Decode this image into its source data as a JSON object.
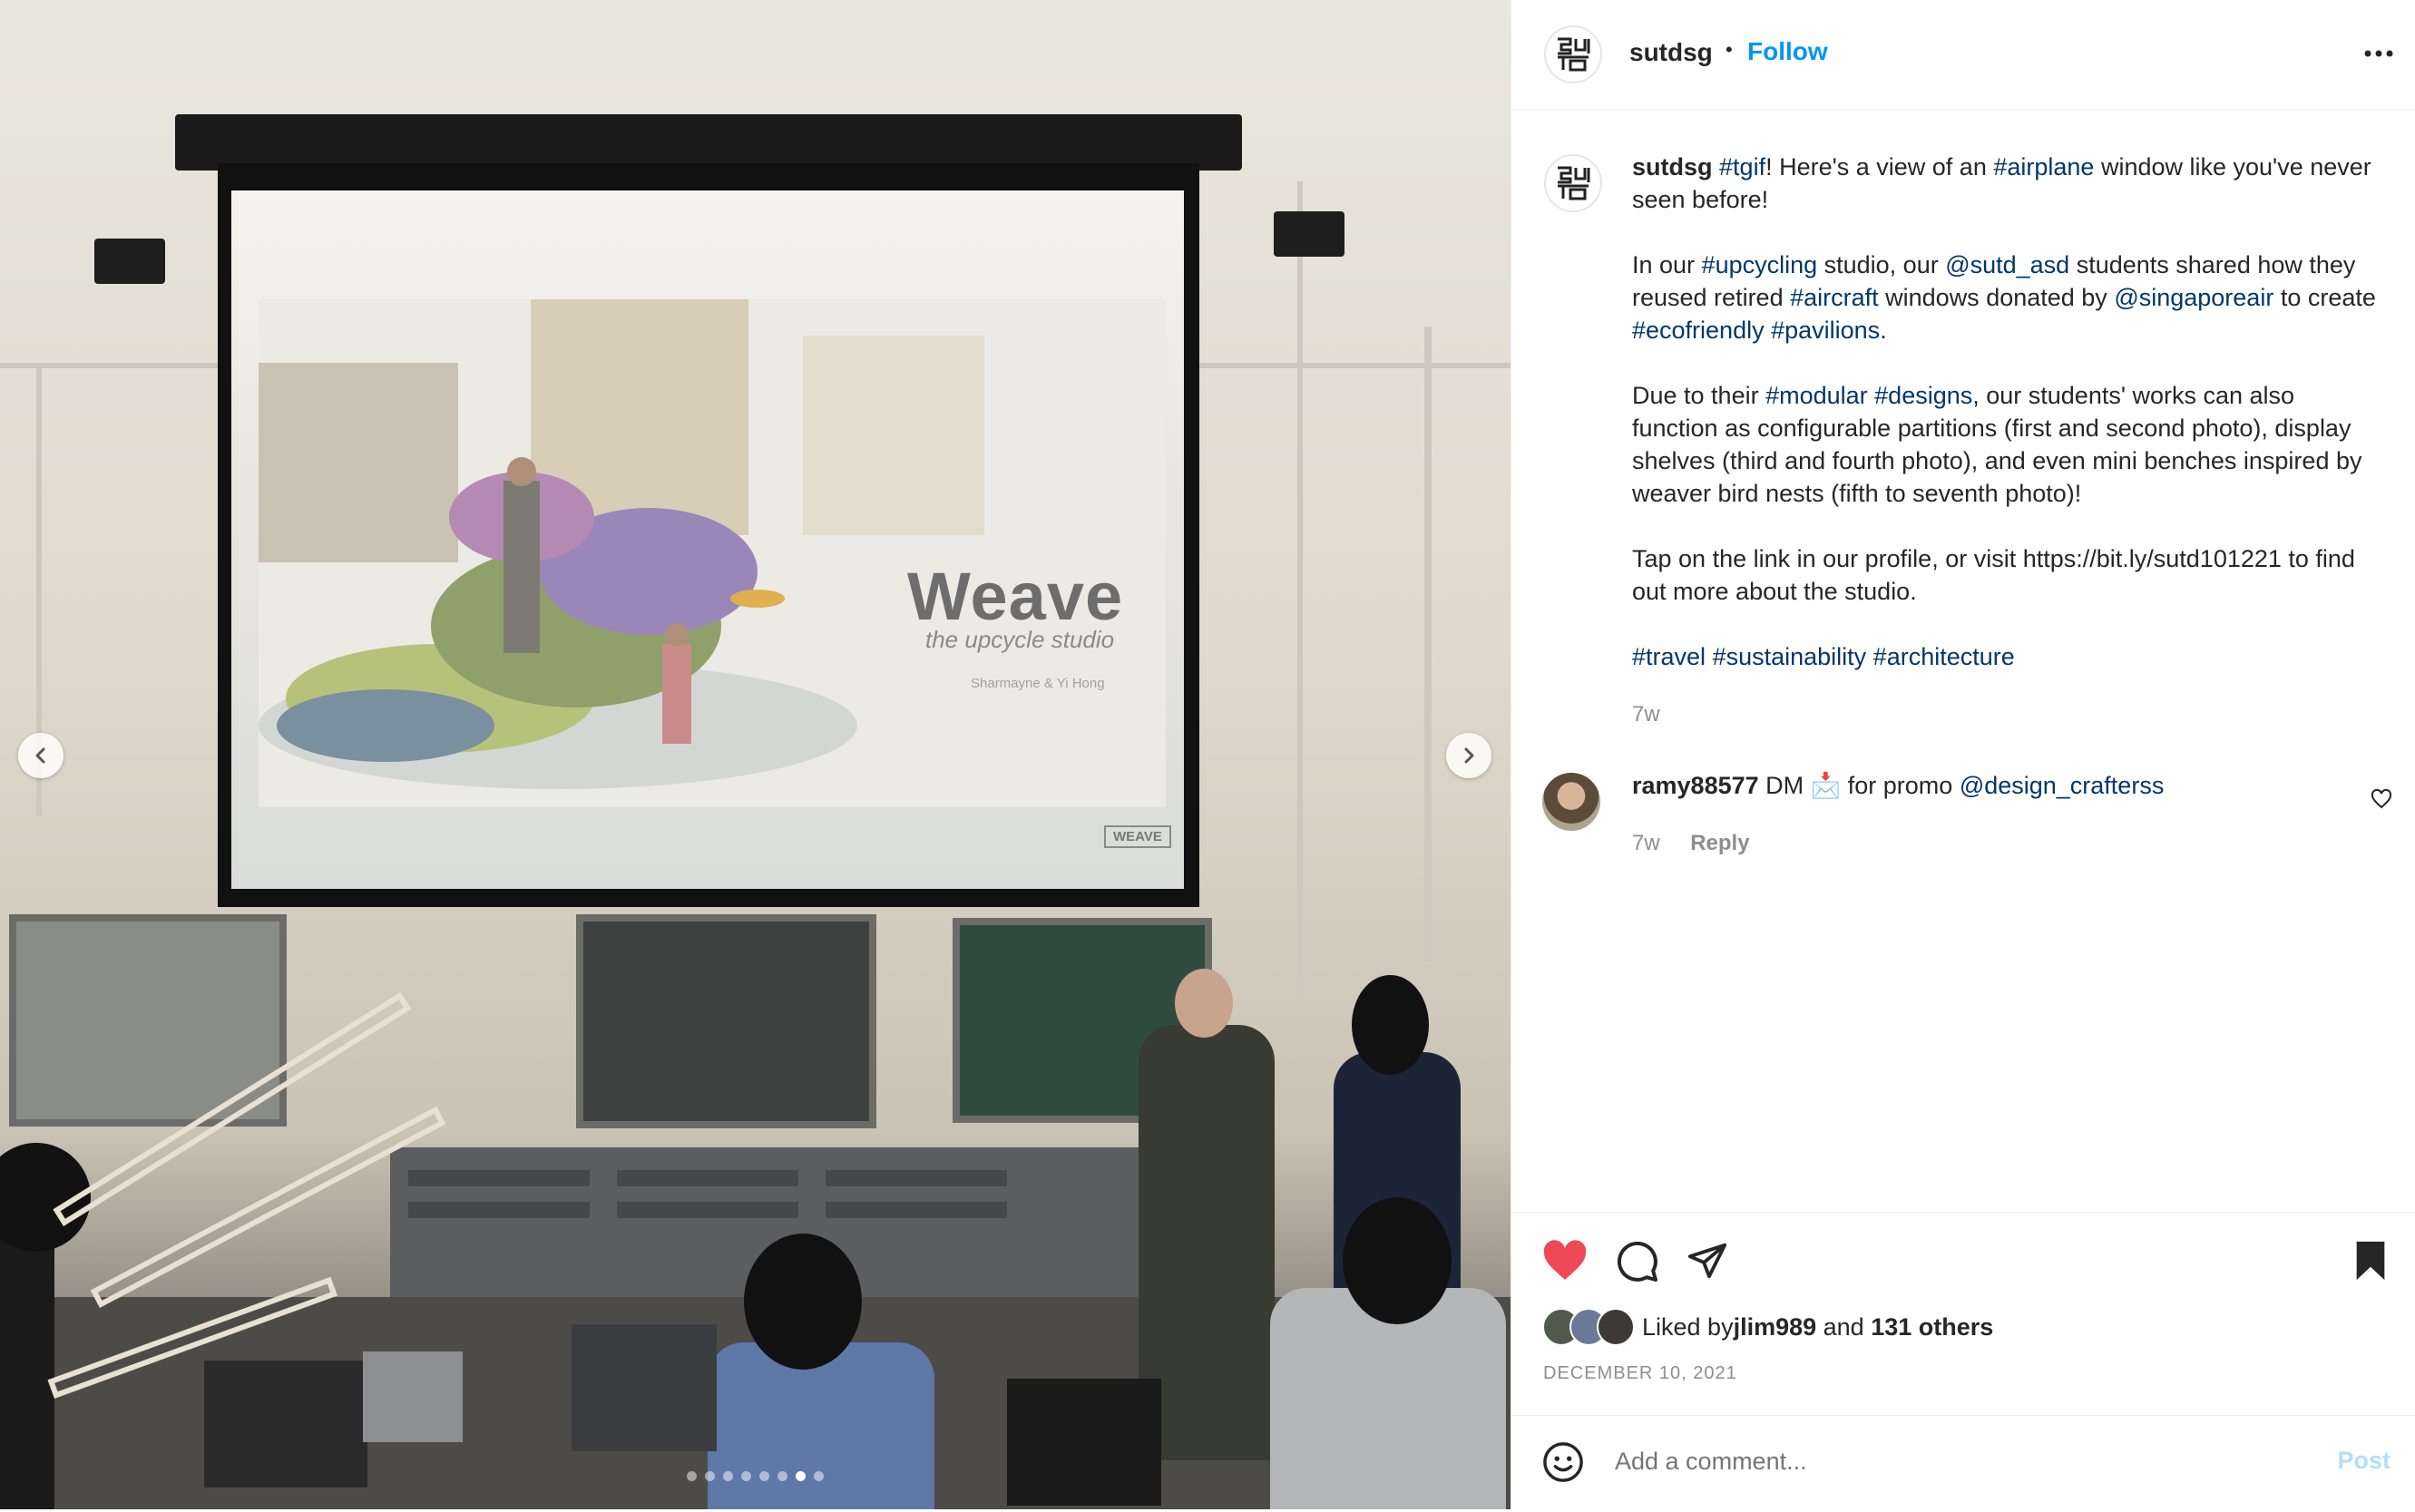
{
  "post": {
    "username": "sutdsg",
    "separator": "•",
    "follow_label": "Follow",
    "more_icon": "more-options-icon"
  },
  "slide": {
    "title": "Weave",
    "subtitle": "the upcycle studio",
    "credit": "Sharmayne & Yi Hong",
    "logo": "WEAVE"
  },
  "carousel": {
    "dot_count": 8,
    "active_index": 6
  },
  "caption": {
    "username": "sutdsg",
    "p1": [
      {
        "t": " ",
        "tag": false
      },
      {
        "t": "#tgif",
        "tag": true
      },
      {
        "t": "! Here's a view of an ",
        "tag": false
      },
      {
        "t": "#airplane",
        "tag": true
      },
      {
        "t": " window like you've never seen before!",
        "tag": false
      }
    ],
    "p2": [
      {
        "t": "In our ",
        "tag": false
      },
      {
        "t": "#upcycling",
        "tag": true
      },
      {
        "t": " studio, our ",
        "tag": false
      },
      {
        "t": "@sutd_asd",
        "tag": true
      },
      {
        "t": " students shared how they reused retired ",
        "tag": false
      },
      {
        "t": "#aircraft",
        "tag": true
      },
      {
        "t": " windows donated by ",
        "tag": false
      },
      {
        "t": "@singaporeair",
        "tag": true
      },
      {
        "t": " to create ",
        "tag": false
      },
      {
        "t": "#ecofriendly",
        "tag": true
      },
      {
        "t": " ",
        "tag": false
      },
      {
        "t": "#pavilions",
        "tag": true
      },
      {
        "t": ".",
        "tag": false
      }
    ],
    "p3": [
      {
        "t": "Due to their ",
        "tag": false
      },
      {
        "t": "#modular",
        "tag": true
      },
      {
        "t": " ",
        "tag": false
      },
      {
        "t": "#designs",
        "tag": true
      },
      {
        "t": ", our students' works can also function as configurable partitions (first and second photo), display shelves (third and fourth photo), and even mini benches inspired by weaver bird nests (fifth to seventh photo)!",
        "tag": false
      }
    ],
    "p4": [
      {
        "t": "Tap on the link in our profile, or visit https://bit.ly/sutd101221 to find out more about the studio.",
        "tag": false
      }
    ],
    "p5": [
      {
        "t": "#travel",
        "tag": true
      },
      {
        "t": " ",
        "tag": false
      },
      {
        "t": "#sustainability",
        "tag": true
      },
      {
        "t": " ",
        "tag": false
      },
      {
        "t": "#architecture",
        "tag": true
      }
    ],
    "time": "7w"
  },
  "comment": {
    "username": "ramy88577",
    "text_before": " DM ",
    "emoji": "📩",
    "text_after": " for promo ",
    "mention": "@design_crafterss",
    "time": "7w",
    "reply_label": "Reply"
  },
  "likes": {
    "prefix": "Liked by ",
    "user": "jlim989",
    "middle": " and ",
    "others": "131 others"
  },
  "date": "DECEMBER 10, 2021",
  "add_comment": {
    "placeholder": "Add a comment...",
    "post_label": "Post"
  },
  "colors": {
    "accent": "#0095f6",
    "hashtag": "#00376b",
    "heart": "#ed4956",
    "muted": "#8e8e8e"
  }
}
